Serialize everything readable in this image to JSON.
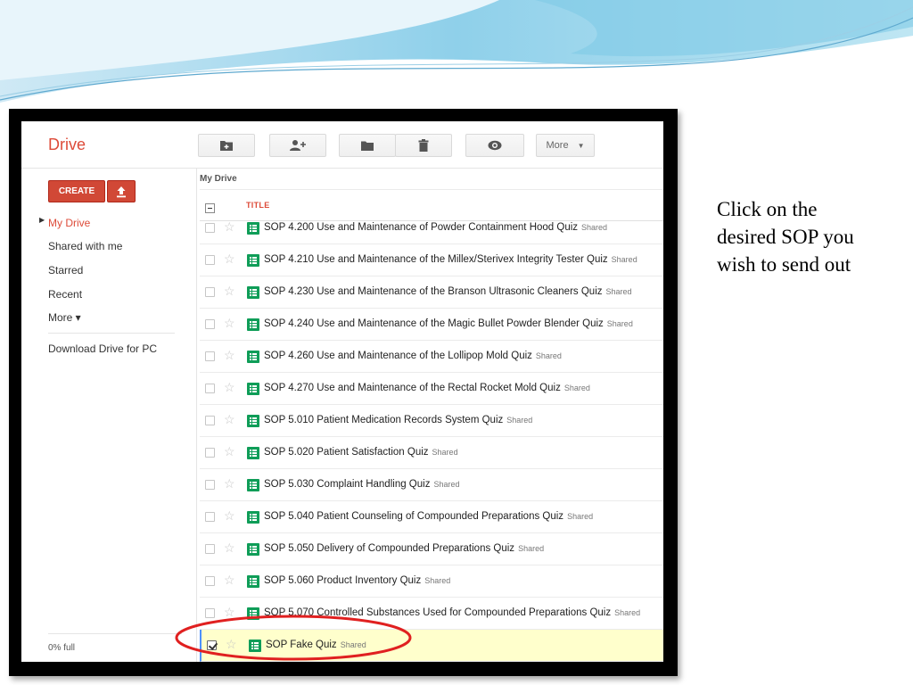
{
  "caption": {
    "line1": "Click on the",
    "line2": "desired SOP you",
    "line3": "wish to send out"
  },
  "drive": {
    "logo": "Drive",
    "toolbar": {
      "new_folder_icon": "new-folder-icon",
      "share_icon": "add-person-icon",
      "move_icon": "folder-icon",
      "delete_icon": "trash-icon",
      "preview_icon": "eye-icon",
      "more_label": "More"
    },
    "sidebar": {
      "create_label": "CREATE",
      "upload_icon": "upload-icon",
      "items": [
        {
          "label": "My Drive"
        },
        {
          "label": "Shared with me"
        },
        {
          "label": "Starred"
        },
        {
          "label": "Recent"
        },
        {
          "label": "More ▾"
        },
        {
          "label": "Download Drive for PC"
        }
      ],
      "storage": "0% full"
    },
    "breadcrumb": "My Drive",
    "column_title": "TITLE",
    "shared_label": "Shared",
    "files": [
      {
        "name": "SOP 4.200 Use and Maintenance of Powder Containment Hood Quiz",
        "shared": "Shared",
        "checked": false
      },
      {
        "name": "SOP 4.210 Use and Maintenance of the Millex/Sterivex Integrity Tester Quiz",
        "shared": "Shared",
        "checked": false
      },
      {
        "name": "SOP 4.230 Use and Maintenance of the Branson Ultrasonic Cleaners Quiz",
        "shared": "Shared",
        "checked": false
      },
      {
        "name": "SOP 4.240 Use and Maintenance of the Magic Bullet Powder Blender Quiz",
        "shared": "Shared",
        "checked": false
      },
      {
        "name": "SOP 4.260 Use and Maintenance of the Lollipop Mold Quiz",
        "shared": "Shared",
        "checked": false
      },
      {
        "name": "SOP 4.270 Use and Maintenance of the Rectal Rocket Mold Quiz",
        "shared": "Shared",
        "checked": false
      },
      {
        "name": "SOP 5.010 Patient Medication Records System Quiz",
        "shared": "Shared",
        "checked": false
      },
      {
        "name": "SOP 5.020 Patient Satisfaction Quiz",
        "shared": "Shared",
        "checked": false
      },
      {
        "name": "SOP 5.030 Complaint Handling Quiz",
        "shared": "Shared",
        "checked": false
      },
      {
        "name": "SOP 5.040 Patient Counseling of Compounded Preparations Quiz",
        "shared": "Shared",
        "checked": false
      },
      {
        "name": "SOP 5.050 Delivery of Compounded Preparations Quiz",
        "shared": "Shared",
        "checked": false
      },
      {
        "name": "SOP 5.060 Product Inventory Quiz",
        "shared": "Shared",
        "checked": false
      },
      {
        "name": "SOP 5.070 Controlled Substances Used for Compounded Preparations Quiz",
        "shared": "Shared",
        "checked": false
      },
      {
        "name": "SOP Fake Quiz",
        "shared": "Shared",
        "checked": true
      }
    ],
    "colors": {
      "accent": "#dd4b39",
      "create_button": "#d14836",
      "form_icon": "#0f9d58",
      "selected_row": "#ffffcc",
      "annotation": "#e02020"
    }
  }
}
